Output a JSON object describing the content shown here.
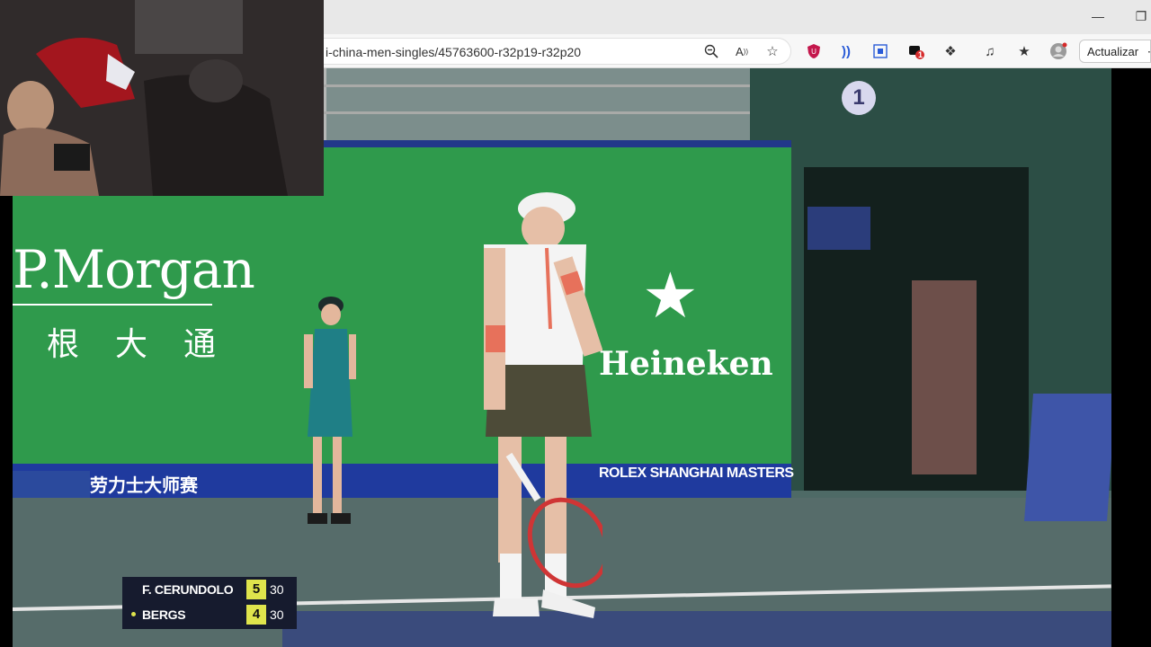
{
  "browser": {
    "url_fragment": "i-china-men-singles/45763600-r32p19-r32p20",
    "update_button_label": "Actualizar",
    "extensions_badge_count": "1",
    "colors": {
      "shield_ext": "#c4174c",
      "toolbar_bg": "#f7f7f7"
    }
  },
  "video": {
    "court_number": "1",
    "ads": {
      "sponsor_left": "P.Morgan",
      "sponsor_left_cn": "根大通",
      "sponsor_right": "Heineken",
      "banner_cn": "劳力士大师赛",
      "banner_en": "ROLEX SHANGHAI MASTERS"
    },
    "scoreboard": {
      "players": [
        {
          "name": "F. CERUNDOLO",
          "games": "5",
          "points": "30",
          "serving": false
        },
        {
          "name": "BERGS",
          "games": "4",
          "points": "30",
          "serving": true
        }
      ],
      "accent": "#dfe44c"
    }
  }
}
